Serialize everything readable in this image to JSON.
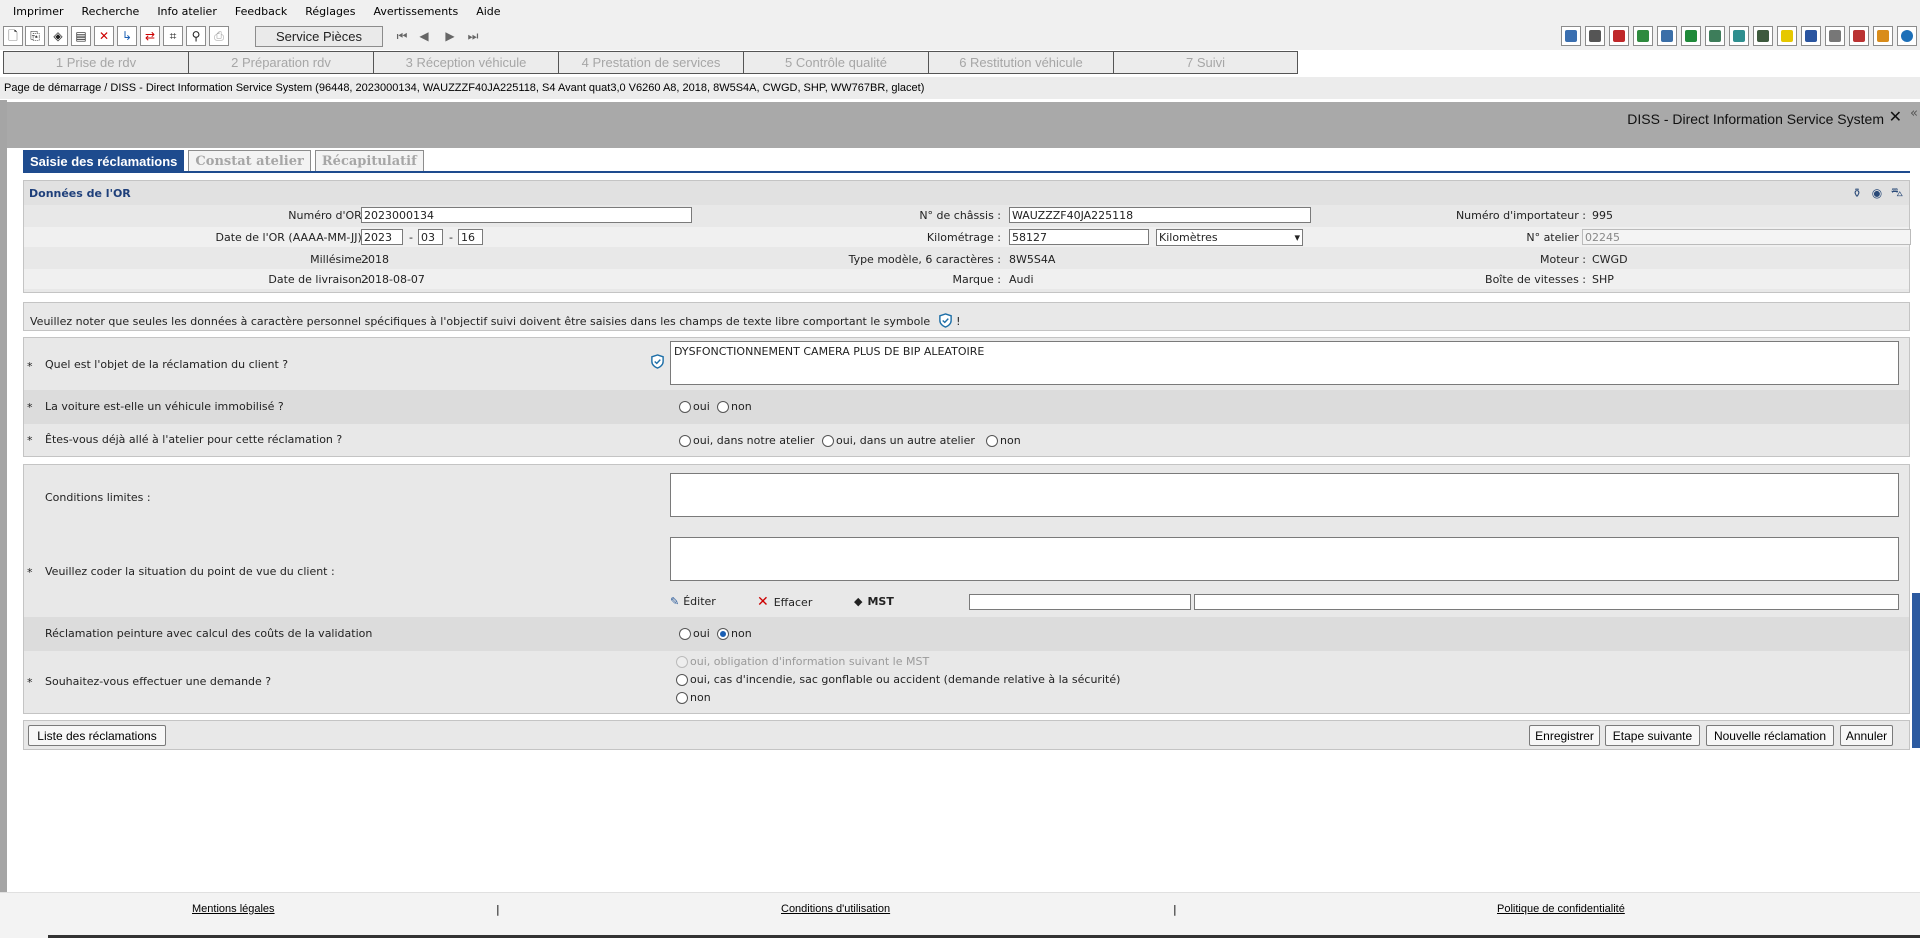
{
  "menu": [
    "Imprimer",
    "Recherche",
    "Info atelier",
    "Feedback",
    "Réglages",
    "Avertissements",
    "Aide"
  ],
  "toolbar": {
    "service_pieces": "Service Pièces"
  },
  "workflow": [
    "1 Prise de rdv",
    "2 Préparation rdv",
    "3 Réception véhicule",
    "4 Prestation de services",
    "5 Contrôle qualité",
    "6 Restitution véhicule",
    "7 Suivi"
  ],
  "breadcrumb": "Page de démarrage / DISS - Direct Information Service System (96448, 2023000134, WAUZZZF40JA225118, S4 Avant quat3,0 V6260 A8, 2018, 8W5S4A, CWGD, SHP, WW767BR, glacet)",
  "frame_title": "DISS - Direct Information Service System",
  "tabs": [
    "Saisie des réclamations",
    "Constat atelier",
    "Récapitulatif"
  ],
  "or": {
    "title": "Données de l'OR",
    "numero_or_label": "Numéro d'OR :",
    "numero_or": "2023000134",
    "chassis_label": "N° de châssis :",
    "chassis": "WAUZZZF40JA225118",
    "importateur_label": "Numéro d'importateur :",
    "importateur": "995",
    "date_label": "Date de l'OR (AAAA-MM-JJ) :",
    "date_year": "2023",
    "date_month": "03",
    "date_day": "16",
    "km_label": "Kilométrage :",
    "km": "58127",
    "km_unit": "Kilomètres",
    "atelier_label": "N° atelier :",
    "atelier": "02245",
    "millesime_label": "Millésime :",
    "millesime": "2018",
    "type_label": "Type modèle, 6 caractères :",
    "type": "8W5S4A",
    "moteur_label": "Moteur :",
    "moteur": "CWGD",
    "livraison_label": "Date de livraison :",
    "livraison": "2018-08-07",
    "marque_label": "Marque :",
    "marque": "Audi",
    "boite_label": "Boîte de vitesses :",
    "boite": "SHP"
  },
  "privacy_note": "Veuillez noter que seules les données à caractère personnel spécifiques à l'objectif suivi doivent être saisies dans les champs de texte libre comportant le symbole",
  "privacy_end": "!",
  "questions": {
    "objet_label": "Quel est l'objet de la réclamation du client ?",
    "objet_value": "DYSFONCTIONNEMENT CAMERA   PLUS DE BIP ALEATOIRE",
    "immobilise_label": "La voiture est-elle un véhicule immobilisé ?",
    "atelier_label": "Êtes-vous déjà allé à l'atelier pour cette réclamation ?",
    "opt_oui": "oui",
    "opt_non": "non",
    "opt_notre_atelier": "oui, dans notre atelier",
    "opt_autre_atelier": "oui, dans un autre atelier"
  },
  "conditions": {
    "limites_label": "Conditions limites :",
    "coder_label": "Veuillez coder la situation du point de vue du client :",
    "editer": "Éditer",
    "effacer": "Effacer",
    "mst": "MST",
    "peinture_label": "Réclamation peinture avec calcul des coûts de la validation",
    "demande_label": "Souhaitez-vous effectuer une demande ?",
    "opt_obligation": "oui, obligation d'information suivant le MST",
    "opt_incendie": "oui, cas d'incendie, sac gonflable ou accident (demande relative à la sécurité)"
  },
  "buttons": {
    "liste": "Liste des réclamations",
    "enregistrer": "Enregistrer",
    "etape": "Etape suivante",
    "nouvelle": "Nouvelle réclamation",
    "annuler": "Annuler"
  },
  "footer": {
    "mentions": "Mentions légales",
    "conditions": "Conditions d'utilisation",
    "politique": "Politique de confidentialité",
    "sep": "|"
  },
  "colors": {
    "accent": "#1e4b8e",
    "frame_head": "#a9a9a9"
  }
}
